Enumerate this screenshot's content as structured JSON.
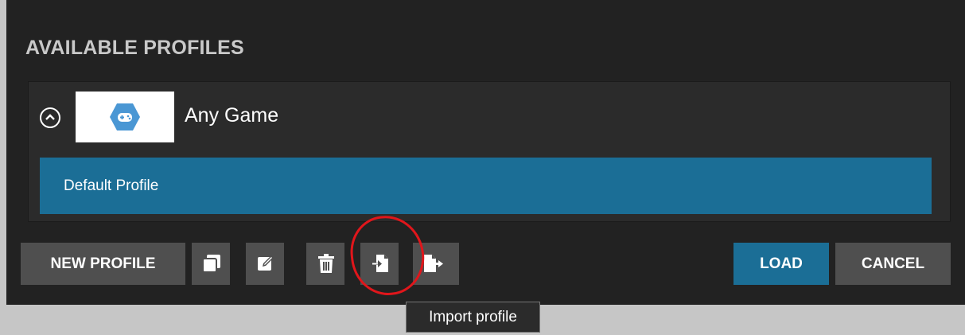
{
  "dialog": {
    "title": "AVAILABLE PROFILES"
  },
  "game": {
    "name": "Any Game",
    "icon": "gamepad-hex-icon",
    "expanded": true
  },
  "profiles": [
    {
      "name": "Default Profile",
      "selected": true
    }
  ],
  "toolbar": {
    "new_profile_label": "NEW PROFILE",
    "icons": [
      "duplicate-icon",
      "edit-icon",
      "delete-icon",
      "import-icon",
      "export-icon"
    ],
    "load_label": "LOAD",
    "cancel_label": "CANCEL"
  },
  "tooltip": {
    "text": "Import profile"
  },
  "colors": {
    "dialog_bg": "#222222",
    "selection": "#1b6e96",
    "button": "#4f4f4f",
    "annotation": "#e0161b"
  }
}
